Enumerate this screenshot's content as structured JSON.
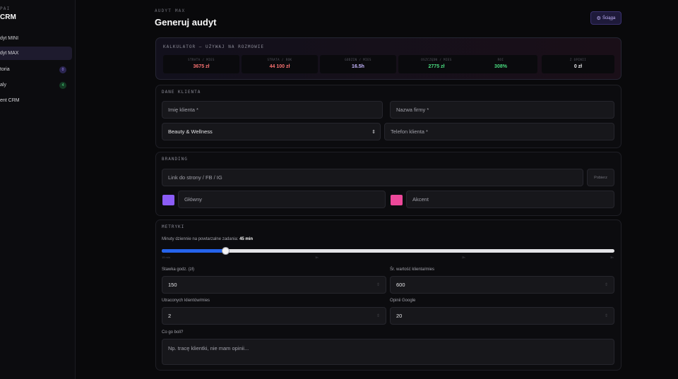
{
  "sidebar": {
    "brand_small": "PAI",
    "brand_big": "CRM",
    "items": [
      {
        "label": "dyt MINI"
      },
      {
        "label": "dyt MAX"
      },
      {
        "label": "toria",
        "badge": "0"
      },
      {
        "label": "aly",
        "badge": "4"
      },
      {
        "label": "ent CRM"
      }
    ]
  },
  "header": {
    "eyebrow": "AUDYT MAX",
    "title": "Generuj audyt",
    "cheat_label": "Ściąga",
    "cheat_icon": "settings-icon"
  },
  "calculator": {
    "title": "KALKULATOR — UŻYWAJ NA ROZMOWIE",
    "stats": [
      {
        "label": "STRATA / MIES",
        "value": "3675 zł",
        "color": "#f87171"
      },
      {
        "label": "STRATA / ROK",
        "value": "44 100 zł",
        "color": "#f87171"
      },
      {
        "label": "GODZIN / MIES",
        "value": "16.5h",
        "color": "#c4b5fd"
      },
      {
        "label": "OSZCZĘDN / MIES",
        "value": "2775 zł",
        "color": "#4ade80"
      },
      {
        "label": "ROI",
        "value": "308%",
        "color": "#4ade80"
      },
      {
        "label": "Z OPINII",
        "value": "0 zł",
        "color": "#e4e4e7"
      }
    ]
  },
  "client": {
    "title": "DANE KLIENTA",
    "name_placeholder": "Imię klienta *",
    "company_placeholder": "Nazwa firmy *",
    "industry_value": "Beauty & Wellness",
    "phone_placeholder": "Telefon klienta *"
  },
  "branding": {
    "title": "BRANDING",
    "link_placeholder": "Link do strony / FB / IG",
    "fetch_label": "Pobierz",
    "primary_label": "Główny",
    "primary_color": "#8b5cf6",
    "accent_label": "Akcent",
    "accent_color": "#ec4899"
  },
  "metrics": {
    "title": "METRYKI",
    "slider_label": "Minuty dziennie na powtarzalne zadania:",
    "slider_value_text": "45 min",
    "slider_fraction": 0.14,
    "ticks": [
      "15 min",
      "1h",
      "2h",
      "3h"
    ],
    "rate_label": "Stawka godz. (zł)",
    "rate_value": "150",
    "avg_label": "Śr. wartość klienta/mies",
    "avg_value": "600",
    "lost_label": "Utraconych klientów/mies",
    "lost_value": "2",
    "reviews_label": "Opinii Google",
    "reviews_value": "20",
    "pain_label": "Co go boli?",
    "pain_placeholder": "Np. tracę klientki, nie mam opinii..."
  }
}
